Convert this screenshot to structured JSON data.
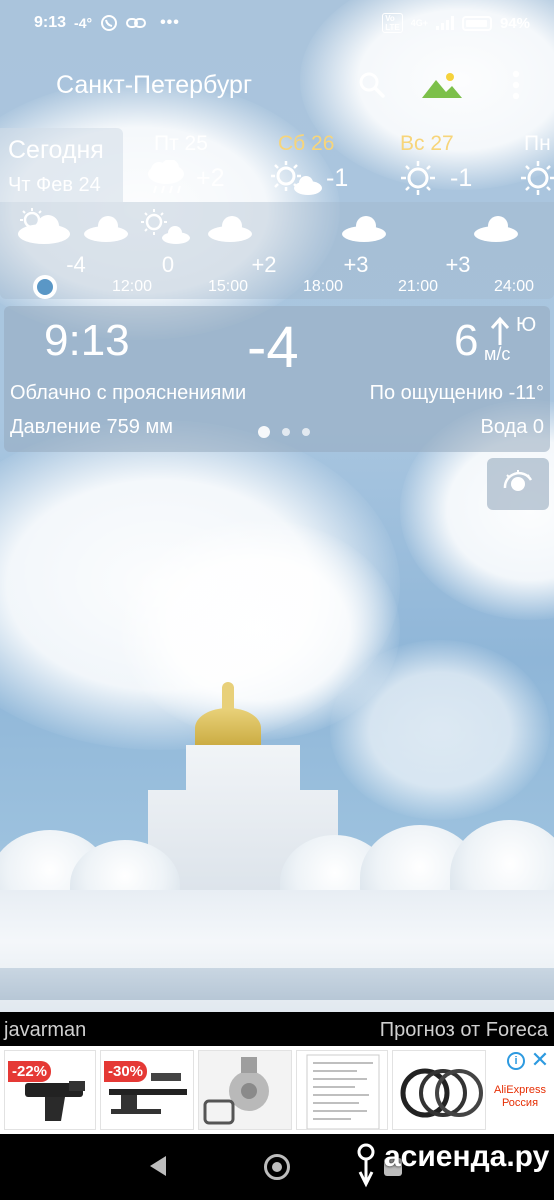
{
  "status_bar": {
    "time": "9:13",
    "temp": "-4°",
    "more": "•••",
    "network": "4G+",
    "battery": "94%"
  },
  "app": {
    "city": "Санкт-Петербург"
  },
  "today": {
    "label": "Сегодня",
    "date": "Чт Фев 24"
  },
  "days": [
    {
      "name": "Пт 25",
      "temp": "+2",
      "icon": "rain-cloud-icon",
      "weekend": false
    },
    {
      "name": "Сб 26",
      "temp": "-1",
      "icon": "sun-cloud-icon",
      "weekend": true
    },
    {
      "name": "Вс 27",
      "temp": "-1",
      "icon": "sun-icon",
      "weekend": true
    },
    {
      "name": "Пн",
      "temp": "",
      "icon": "sun-icon",
      "weekend": false
    }
  ],
  "hourly": {
    "temps": [
      "-4",
      "0",
      "+2",
      "+3",
      "+3"
    ],
    "times": [
      "12:00",
      "15:00",
      "18:00",
      "21:00",
      "24:00"
    ]
  },
  "current": {
    "time": "9:13",
    "temp": "-4",
    "wind_speed": "6",
    "wind_dir": "Ю",
    "wind_unit": "м/с",
    "description": "Облачно с прояснениями",
    "feels_like": "По ощущению -11°",
    "pressure": "Давление 759 мм",
    "water": "Вода 0"
  },
  "footer": {
    "author": "javarman",
    "source": "Прогноз от Foreca"
  },
  "ad": {
    "items": [
      {
        "discount": "-22%"
      },
      {
        "discount": "-30%"
      },
      {
        "discount": ""
      },
      {
        "discount": ""
      },
      {
        "discount": ""
      }
    ],
    "brand_line1": "AliExpress",
    "brand_line2": "Россия",
    "info": "i",
    "close": "✕"
  },
  "watermark": "асиенда.ру",
  "colors": {
    "weekend_day": "#f7d57a",
    "accent_dot": "#5a97c6",
    "ad_close": "#2d9ae0"
  }
}
